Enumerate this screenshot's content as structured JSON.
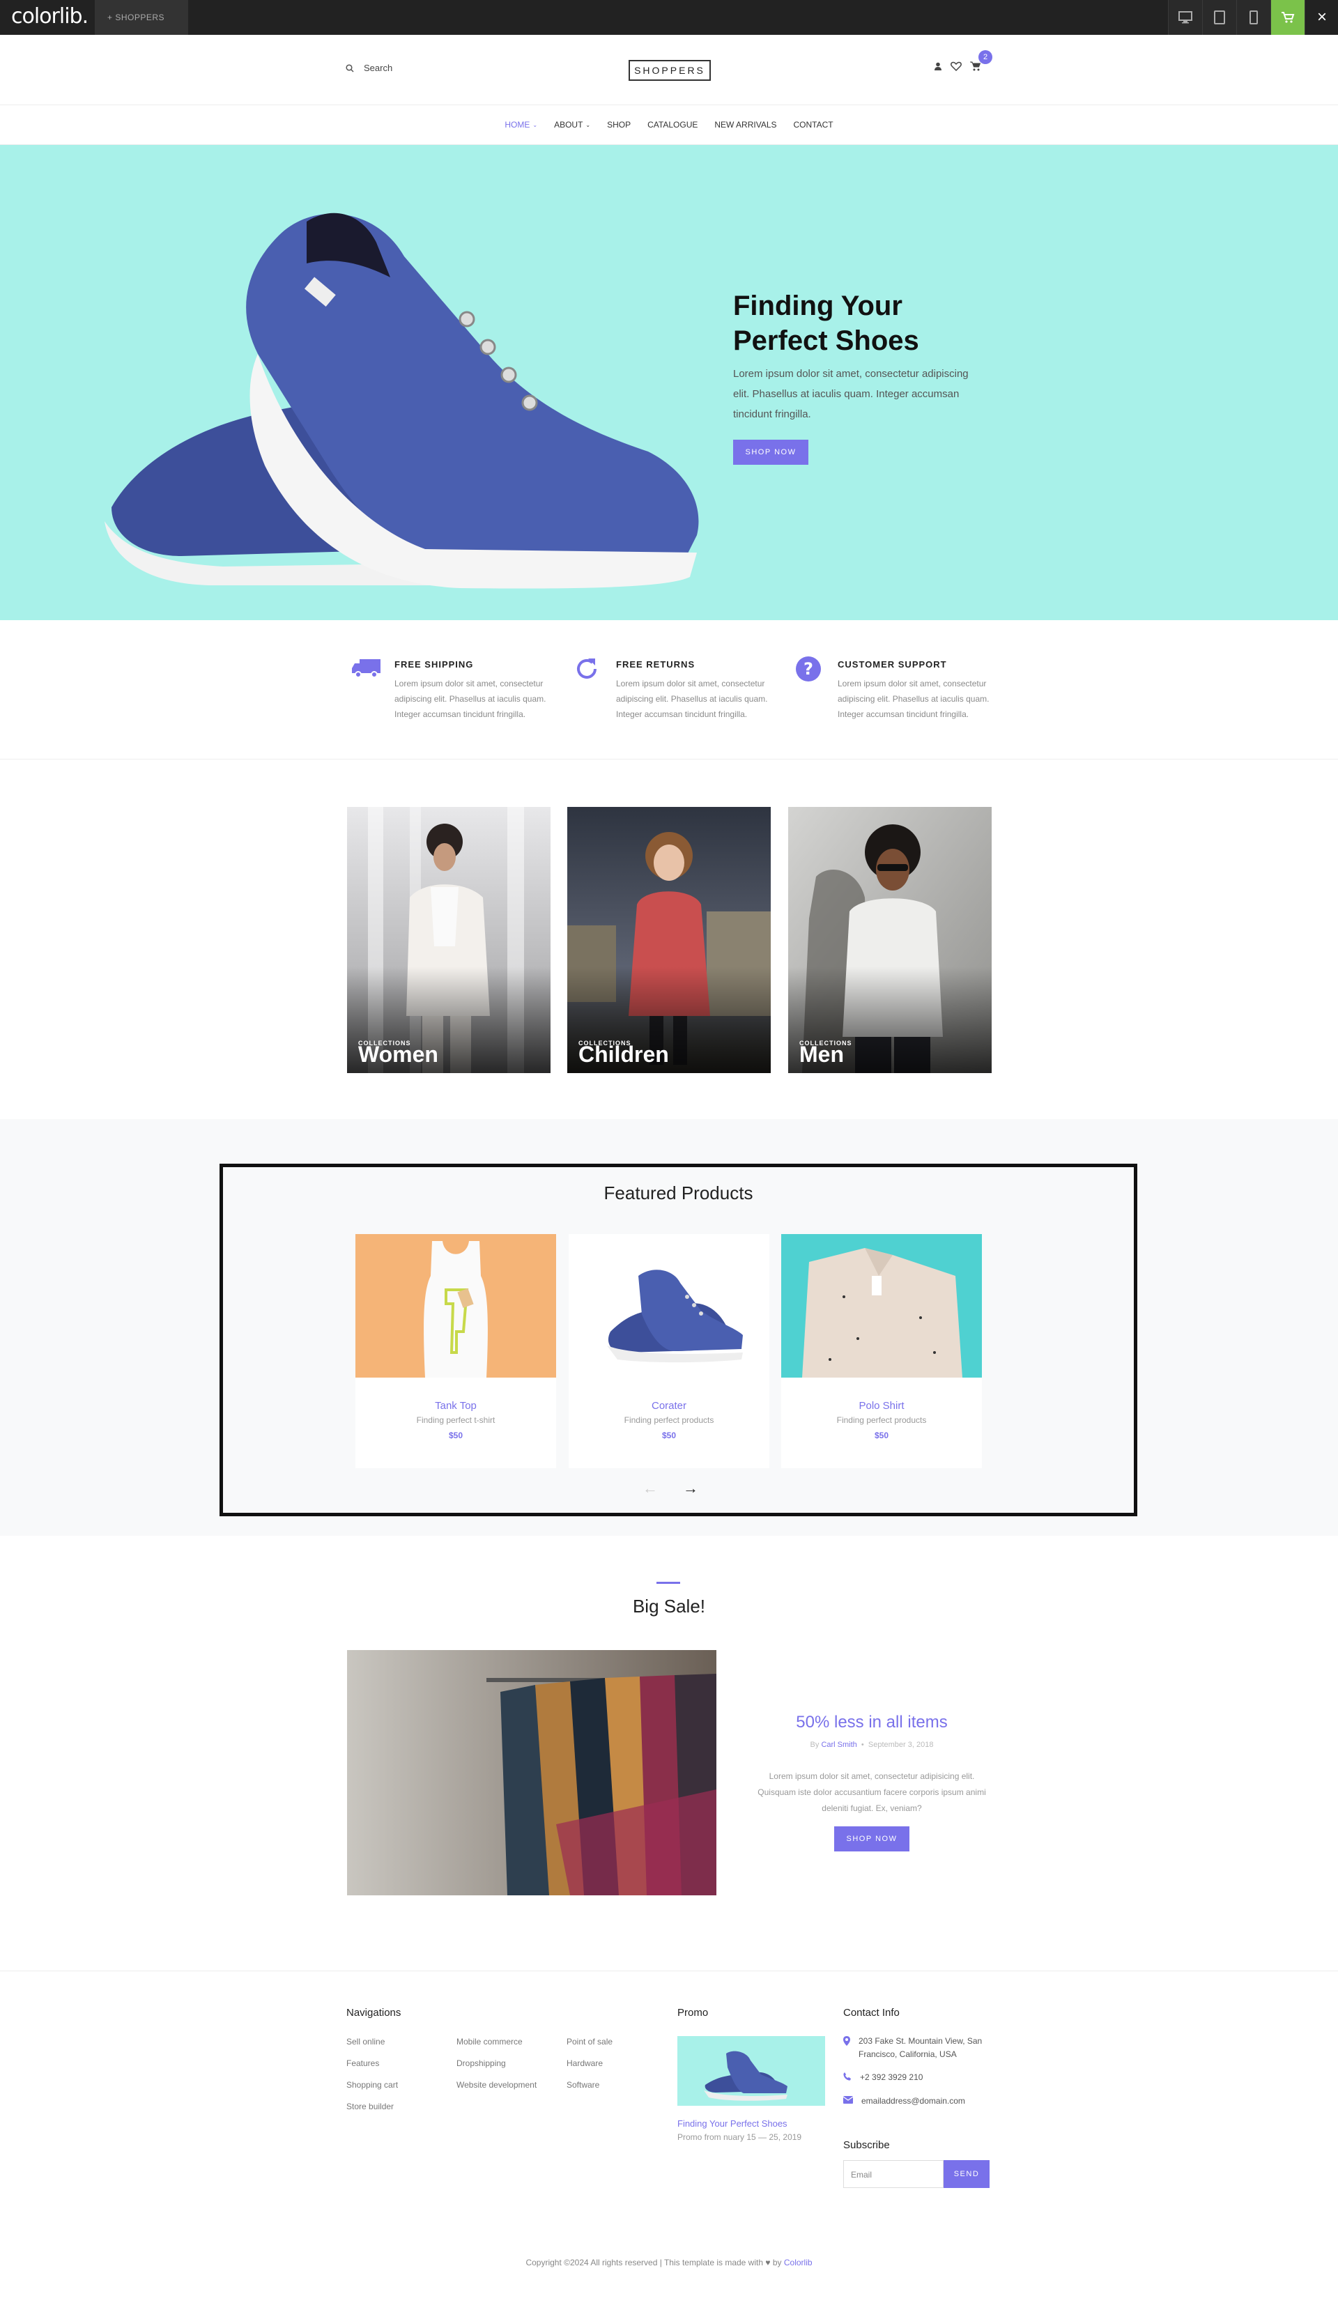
{
  "topbar": {
    "logo": "colorlib.",
    "template_label": "+ SHOPPERS"
  },
  "header": {
    "search_placeholder": "Search",
    "brand": "SHOPPERS",
    "cart_count": "2"
  },
  "nav": {
    "items": [
      "HOME",
      "ABOUT",
      "SHOP",
      "CATALOGUE",
      "NEW ARRIVALS",
      "CONTACT"
    ]
  },
  "hero": {
    "title_line1": "Finding Your",
    "title_line2": "Perfect Shoes",
    "text": "Lorem ipsum dolor sit amet, consectetur adipiscing elit. Phasellus at iaculis quam. Integer accumsan tincidunt fringilla.",
    "button": "SHOP NOW"
  },
  "features": [
    {
      "title": "FREE SHIPPING",
      "text": "Lorem ipsum dolor sit amet, consectetur adipiscing elit. Phasellus at iaculis quam. Integer accumsan tincidunt fringilla."
    },
    {
      "title": "FREE RETURNS",
      "text": "Lorem ipsum dolor sit amet, consectetur adipiscing elit. Phasellus at iaculis quam. Integer accumsan tincidunt fringilla."
    },
    {
      "title": "CUSTOMER SUPPORT",
      "text": "Lorem ipsum dolor sit amet, consectetur adipiscing elit. Phasellus at iaculis quam. Integer accumsan tincidunt fringilla."
    }
  ],
  "collections": [
    {
      "label": "COLLECTIONS",
      "name": "Women"
    },
    {
      "label": "COLLECTIONS",
      "name": "Children"
    },
    {
      "label": "COLLECTIONS",
      "name": "Men"
    }
  ],
  "featured": {
    "title": "Featured Products",
    "products": [
      {
        "name": "Tank Top",
        "desc": "Finding perfect t-shirt",
        "price": "$50"
      },
      {
        "name": "Corater",
        "desc": "Finding perfect products",
        "price": "$50"
      },
      {
        "name": "Polo Shirt",
        "desc": "Finding perfect products",
        "price": "$50"
      }
    ]
  },
  "sale": {
    "title": "Big Sale!",
    "heading": "50% less in all items",
    "by": "By",
    "author": "Carl Smith",
    "date": "September 3, 2018",
    "text": "Lorem ipsum dolor sit amet, consectetur adipisicing elit. Quisquam iste dolor accusantium facere corporis ipsum animi deleniti fugiat. Ex, veniam?",
    "button": "SHOP NOW"
  },
  "footer": {
    "nav_title": "Navigations",
    "col1": [
      "Sell online",
      "Features",
      "Shopping cart",
      "Store builder"
    ],
    "col2": [
      "Mobile commerce",
      "Dropshipping",
      "Website development"
    ],
    "col3": [
      "Point of sale",
      "Hardware",
      "Software"
    ],
    "promo_title": "Promo",
    "promo_link": "Finding Your Perfect Shoes",
    "promo_dates": "Promo from nuary 15 — 25, 2019",
    "contact_title": "Contact Info",
    "address": "203 Fake St. Mountain View, San Francisco, California, USA",
    "phone": "+2 392 3929 210",
    "email": "emailaddress@domain.com",
    "subscribe_title": "Subscribe",
    "email_placeholder": "Email",
    "send": "SEND",
    "copyright": "Copyright ©2024 All rights reserved | This template is made with",
    "by": "by",
    "colorlib": "Colorlib"
  },
  "colors": {
    "accent": "#7971ea",
    "hero_bg": "#a8f1e9",
    "topbar": "#222222",
    "cart_green": "#7bc24a"
  }
}
